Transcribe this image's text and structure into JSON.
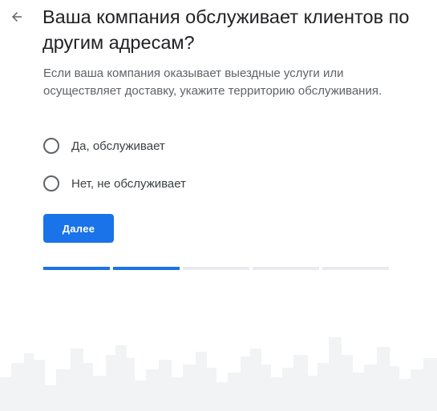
{
  "header": {
    "back_icon": "arrow-left-icon",
    "title": "Ваша компания обслуживает клиентов по другим адресам?"
  },
  "description": "Если ваша компания оказывает выездные услуги или осуществляет доставку, укажите территорию обслуживания.",
  "options": [
    {
      "label": "Да, обслуживает",
      "selected": false
    },
    {
      "label": "Нет, не обслуживает",
      "selected": false
    }
  ],
  "next_button": {
    "label": "Далее"
  },
  "progress": {
    "total_steps": 5,
    "completed_steps": 2
  },
  "colors": {
    "accent": "#1a73e8",
    "progress_inactive": "#e8eaed",
    "skyline": "#f1f3f4"
  }
}
